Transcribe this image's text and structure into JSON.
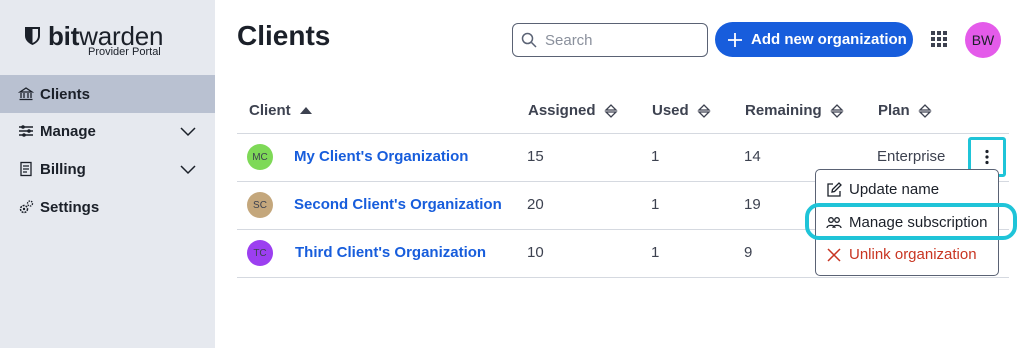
{
  "app": {
    "brand_name_bold": "bit",
    "brand_name_light": "warden",
    "brand_sub": "Provider Portal"
  },
  "sidebar": {
    "items": [
      {
        "label": "Clients",
        "icon": "bank-icon",
        "active": true
      },
      {
        "label": "Manage",
        "icon": "sliders-icon",
        "expandable": true
      },
      {
        "label": "Billing",
        "icon": "billing-icon",
        "expandable": true
      },
      {
        "label": "Settings",
        "icon": "cogs-icon"
      }
    ]
  },
  "header": {
    "title": "Clients",
    "search_placeholder": "Search",
    "add_button_label": "Add new organization",
    "user_initials": "BW",
    "accent_color": "#175ddc",
    "avatar_color": "#e45bea"
  },
  "table": {
    "columns": [
      "Client",
      "Assigned",
      "Used",
      "Remaining",
      "Plan"
    ],
    "sort": {
      "column": "Client",
      "direction": "ascending"
    },
    "rows": [
      {
        "initials": "MC",
        "avatar_color": "#7ed957",
        "name": "My Client's Organization",
        "assigned": "15",
        "used": "1",
        "remaining": "14",
        "plan": "Enterprise"
      },
      {
        "initials": "SC",
        "avatar_color": "#c4a77c",
        "name": "Second Client's Organization",
        "assigned": "20",
        "used": "1",
        "remaining": "19",
        "plan": ""
      },
      {
        "initials": "TC",
        "avatar_color": "#9c3ff0",
        "name": "Third Client's Organization",
        "assigned": "10",
        "used": "1",
        "remaining": "9",
        "plan": ""
      }
    ]
  },
  "row_menu": {
    "items": [
      {
        "label": "Update name",
        "icon": "edit-icon"
      },
      {
        "label": "Manage subscription",
        "icon": "users-icon",
        "highlighted": true
      },
      {
        "label": "Unlink organization",
        "icon": "close-icon",
        "danger": true
      }
    ],
    "highlight_color": "#1fc4d8",
    "danger_color": "#c83522"
  }
}
